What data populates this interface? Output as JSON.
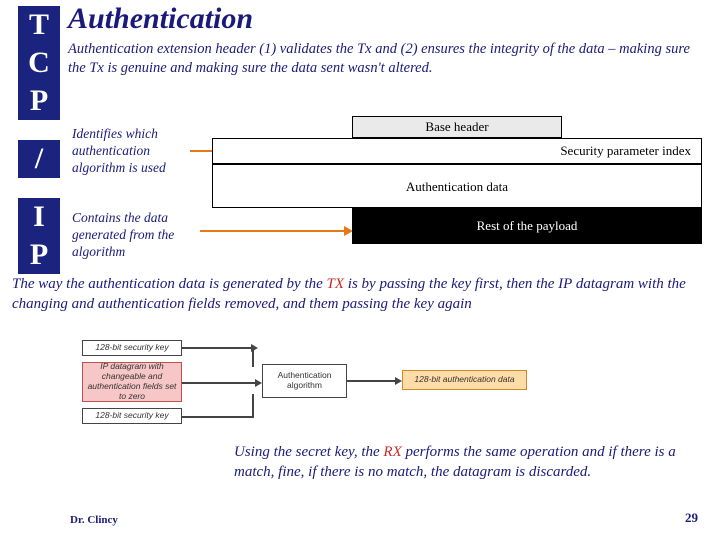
{
  "sidebar": {
    "c0": "T",
    "c1": "C",
    "c2": "P",
    "c3": "/",
    "c4": "I",
    "c5": "P"
  },
  "title": "Authentication",
  "subtitle": "Authentication extension header (1) validates the Tx and (2) ensures the integrity of the data – making sure the Tx is genuine and making sure the data sent wasn't altered.",
  "note1": "Identifies which authentication algorithm is used",
  "note2": "Contains the data generated from the algorithm",
  "diagram": {
    "bh": "Base header",
    "spi": "Security parameter index",
    "auth": "Authentication data",
    "rest": "Rest of the payload"
  },
  "para2_a": "The way the authentication data is generated by the ",
  "tx": "TX",
  "para2_b": " is by passing the key first, then the IP datagram with the changing and authentication fields removed, and them passing the key again",
  "flow": {
    "key1": "128-bit security key",
    "ip": "IP datagram with changeable and authentication fields set to zero",
    "key2": "128-bit security key",
    "algo": "Authentication algorithm",
    "out": "128-bit authentication data"
  },
  "para3_a": "Using the secret key, the ",
  "rx": "RX",
  "para3_b": " performs the same operation and if there is a match, fine, if there is no match, the datagram is discarded.",
  "footer": {
    "left": "Dr. Clincy",
    "right": "29"
  }
}
